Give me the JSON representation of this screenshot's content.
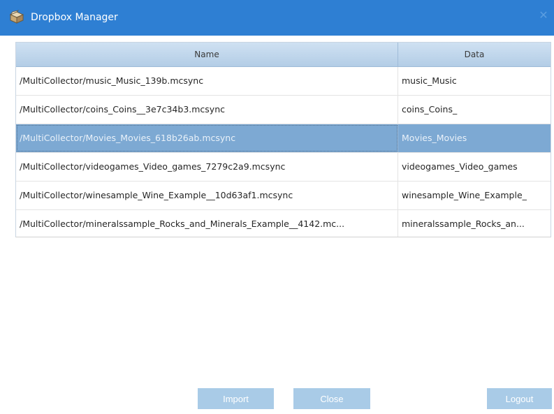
{
  "window": {
    "title": "Dropbox Manager",
    "close_glyph": "✕",
    "icon": "dropbox-box-icon"
  },
  "table": {
    "columns": [
      "Name",
      "Data"
    ],
    "selected_index": 2,
    "rows": [
      {
        "name": "/MultiCollector/music_Music_139b.mcsync",
        "data": "music_Music"
      },
      {
        "name": "/MultiCollector/coins_Coins__3e7c34b3.mcsync",
        "data": "coins_Coins_"
      },
      {
        "name": "/MultiCollector/Movies_Movies_618b26ab.mcsync",
        "data": "Movies_Movies"
      },
      {
        "name": "/MultiCollector/videogames_Video_games_7279c2a9.mcsync",
        "data": "videogames_Video_games"
      },
      {
        "name": "/MultiCollector/winesample_Wine_Example__10d63af1.mcsync",
        "data": "winesample_Wine_Example_"
      },
      {
        "name": "/MultiCollector/mineralssample_Rocks_and_Minerals_Example__4142.mc...",
        "data": "mineralssample_Rocks_an..."
      }
    ]
  },
  "buttons": {
    "import": "Import",
    "close": "Close",
    "logout": "Logout"
  },
  "colors": {
    "titlebar": "#2e7fd3",
    "selection": "#7da9d3",
    "button": "#a9cbe7"
  }
}
